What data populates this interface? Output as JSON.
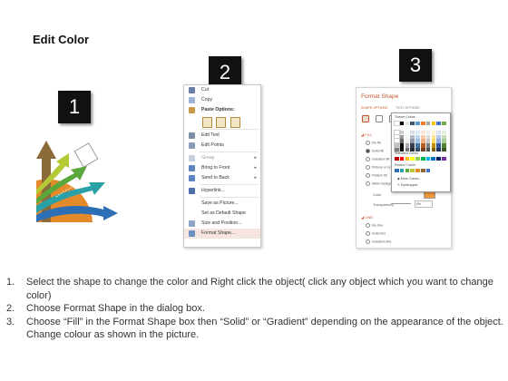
{
  "title": "Edit Color",
  "badges": [
    "1",
    "2",
    "3"
  ],
  "context_menu": {
    "items": [
      {
        "label": "Cut",
        "icon": "scissors-icon"
      },
      {
        "label": "Copy",
        "icon": "copy-icon"
      },
      {
        "label": "Paste Options:",
        "icon": "paste-icon"
      },
      {
        "label": "Edit Text",
        "icon": "text-icon"
      },
      {
        "label": "Edit Points",
        "icon": "points-icon"
      },
      {
        "label": "Group",
        "icon": "group-icon"
      },
      {
        "label": "Bring to Front",
        "icon": "bring-front-icon"
      },
      {
        "label": "Send to Back",
        "icon": "send-back-icon"
      },
      {
        "label": "Hyperlink...",
        "icon": "hyperlink-icon"
      },
      {
        "label": "Save as Picture...",
        "icon": ""
      },
      {
        "label": "Set as Default Shape",
        "icon": ""
      },
      {
        "label": "Size and Position...",
        "icon": "size-icon"
      },
      {
        "label": "Format Shape...",
        "icon": "format-icon"
      }
    ]
  },
  "format_pane": {
    "title": "Format Shape",
    "tabs": [
      "SHAPE OPTIONS",
      "TEXT OPTIONS"
    ],
    "fill_section": "FILL",
    "fill_options": [
      "No fill",
      "Solid fill",
      "Gradient fill",
      "Picture or texture fill",
      "Pattern fill",
      "Slide background fill"
    ],
    "color_label": "Color",
    "transparency_label": "Transparency",
    "transparency_value": "0%",
    "line_section": "LINE",
    "line_options": [
      "No line",
      "Solid line",
      "Gradient line"
    ]
  },
  "color_popup": {
    "theme_label": "Theme Colors",
    "standard_label": "Standard Colors",
    "recent_label": "Recent Colors",
    "more_colors": "More Colors...",
    "eyedropper": "Eyedropper"
  },
  "instructions": [
    {
      "num": "1.",
      "text": "Select the shape to change the color and Right click the object( click any object which you want to change color)"
    },
    {
      "num": "2.",
      "text": "Choose Format Shape in the dialog box."
    },
    {
      "num": "3.",
      "text": "Choose “Fill” in the Format Shape box then “Solid” or “Gradient” depending on the appearance of the object. Change colour as shown in the picture."
    }
  ]
}
